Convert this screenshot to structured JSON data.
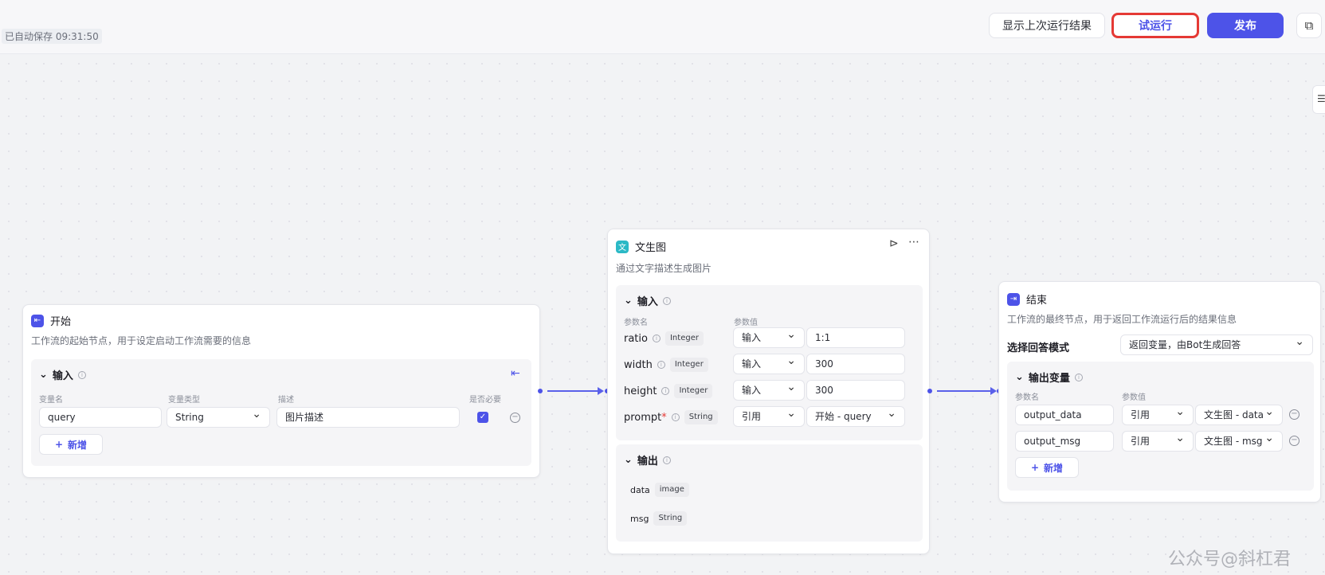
{
  "toolbar": {
    "autosave": "已自动保存 09:31:50",
    "show_last_run": "显示上次运行结果",
    "test_run": "试运行",
    "publish": "发布",
    "copy_icon": "⧉",
    "side_icon": "☰"
  },
  "start_node": {
    "title": "开始",
    "icon": "⇤",
    "description": "工作流的起始节点，用于设定启动工作流需要的信息",
    "section": "输入",
    "col_headers": [
      "变量名",
      "变量类型",
      "描述",
      "是否必要"
    ],
    "rows": [
      {
        "name": "query",
        "type": "String",
        "desc": "图片描述",
        "required": true
      }
    ],
    "add_label": "新增"
  },
  "image_node": {
    "title": "文生图",
    "icon": "文",
    "description": "通过文字描述生成图片",
    "input_section": "输入",
    "col_headers": [
      "参数名",
      "参数值"
    ],
    "params": [
      {
        "name": "ratio",
        "required": false,
        "type": "Integer",
        "mode": "输入",
        "value": "1:1"
      },
      {
        "name": "width",
        "required": false,
        "type": "Integer",
        "mode": "输入",
        "value": "300"
      },
      {
        "name": "height",
        "required": false,
        "type": "Integer",
        "mode": "输入",
        "value": "300"
      },
      {
        "name": "prompt",
        "required": true,
        "type": "String",
        "mode": "引用",
        "value": "开始 - query"
      }
    ],
    "output_section": "输出",
    "outputs": [
      {
        "name": "data",
        "type": "image"
      },
      {
        "name": "msg",
        "type": "String"
      }
    ]
  },
  "end_node": {
    "title": "结束",
    "icon": "⇥",
    "description": "工作流的最终节点，用于返回工作流运行后的结果信息",
    "mode_label": "选择回答模式",
    "mode_value": "返回变量，由Bot生成回答",
    "output_section": "输出变量",
    "col_headers": [
      "参数名",
      "参数值"
    ],
    "rows": [
      {
        "name": "output_data",
        "mode": "引用",
        "value": "文生图 - data"
      },
      {
        "name": "output_msg",
        "mode": "引用",
        "value": "文生图 - msg"
      }
    ],
    "add_label": "新增"
  },
  "watermark": "公众号@斜杠君"
}
